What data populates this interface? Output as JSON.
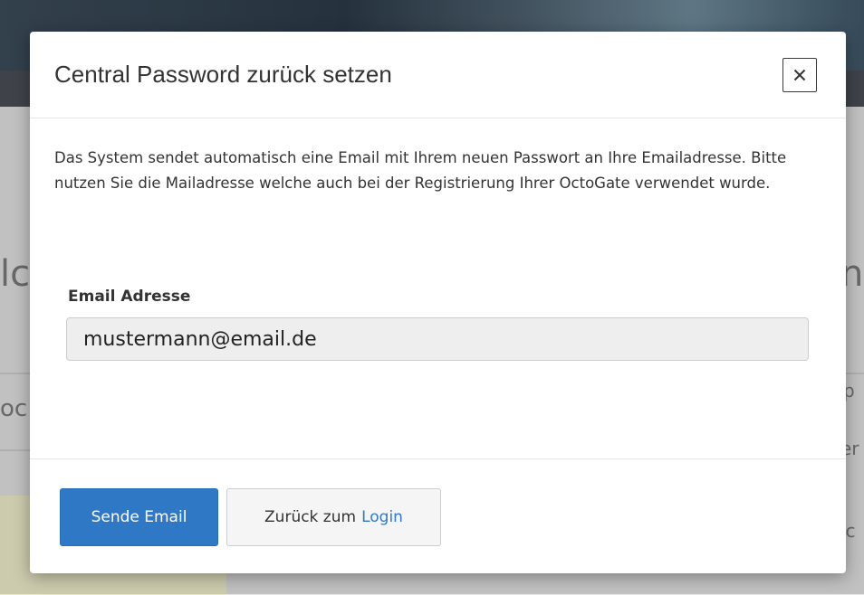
{
  "background": {
    "left_big": "lc",
    "right_big": "n",
    "left_mid": "oc",
    "right_1": "p",
    "right_2": "er",
    "right_3": "ic"
  },
  "modal": {
    "title": "Central Password zurück setzen",
    "close_icon": "close-icon",
    "description": "Das System sendet automatisch eine Email mit Ihrem neuen Passwort an Ihre Emailadresse. Bitte nutzen Sie die Mailadresse welche auch bei der Registrierung Ihrer OctoGate verwendet wurde.",
    "email_label": "Email Adresse",
    "email_value": "mustermann@email.de",
    "send_button_label": "Sende Email",
    "back_button_prefix": "Zurück zum",
    "back_button_link": "Login"
  },
  "colors": {
    "primary": "#2f78c6",
    "link": "#2f78c6",
    "input_bg": "#eeeeee"
  }
}
